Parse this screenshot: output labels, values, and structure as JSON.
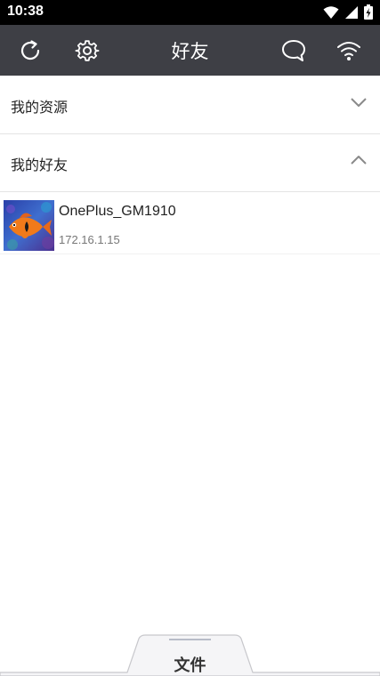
{
  "status_bar": {
    "time": "10:38"
  },
  "toolbar": {
    "title": "好友",
    "icons": [
      "refresh-icon",
      "gear-icon",
      "chat-icon",
      "wifi-icon"
    ]
  },
  "sections": {
    "resources": {
      "label": "我的资源",
      "state": "collapsed"
    },
    "friends": {
      "label": "我的好友",
      "state": "expanded"
    }
  },
  "friends": [
    {
      "name": "OnePlus_GM1910",
      "ip": "172.16.1.15"
    }
  ],
  "bottom_tab": {
    "label": "文件"
  },
  "colors": {
    "toolbar_bg": "#3e3f45",
    "status_bg": "#000000"
  }
}
